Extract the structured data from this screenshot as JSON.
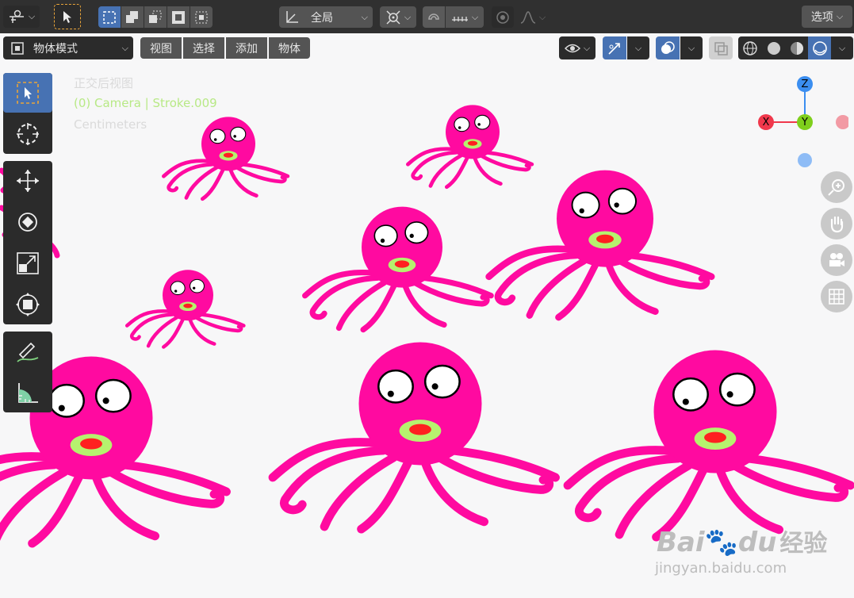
{
  "header": {
    "transform_orientation": "全局",
    "options_label": "选项"
  },
  "subheader": {
    "mode": "物体模式",
    "menus": [
      "视图",
      "选择",
      "添加",
      "物体"
    ]
  },
  "viewport": {
    "view_name": "正交后视图",
    "object_info": "(0) Camera | Stroke.009",
    "units": "Centimeters"
  },
  "gizmo": {
    "z": "Z",
    "x": "X",
    "y": "Y"
  },
  "watermark": {
    "brand": "Bai",
    "brand2": "du",
    "suffix": "经验",
    "url": "jingyan.baidu.com"
  },
  "colors": {
    "accent": "#4772b3",
    "octopus": "#ff0aa0",
    "mouth_outer": "#b6f26e",
    "mouth_inner": "#ff2020"
  }
}
